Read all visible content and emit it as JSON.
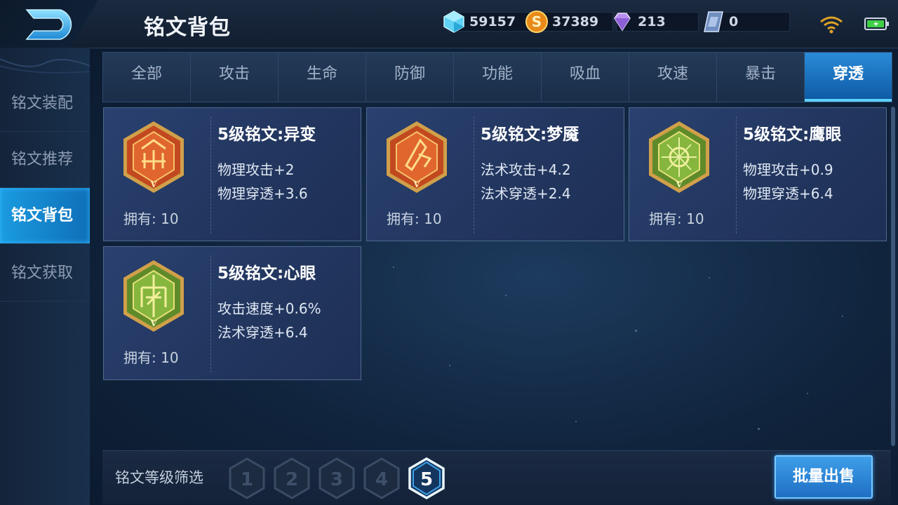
{
  "header": {
    "title": "铭文背包",
    "currencies": [
      {
        "icon": "diamond-icon",
        "amount": "59157"
      },
      {
        "icon": "gold-coin-icon",
        "amount": "37389"
      },
      {
        "icon": "gem-icon",
        "amount": "213"
      },
      {
        "icon": "voucher-icon",
        "amount": "0"
      }
    ]
  },
  "sidebar": {
    "items": [
      {
        "label": "铭文装配",
        "active": false
      },
      {
        "label": "铭文推荐",
        "active": false
      },
      {
        "label": "铭文背包",
        "active": true
      },
      {
        "label": "铭文获取",
        "active": false
      }
    ]
  },
  "tabs": [
    {
      "label": "全部"
    },
    {
      "label": "攻击"
    },
    {
      "label": "生命"
    },
    {
      "label": "防御"
    },
    {
      "label": "功能"
    },
    {
      "label": "吸血"
    },
    {
      "label": "攻速"
    },
    {
      "label": "暴击"
    },
    {
      "label": "穿透",
      "active": true
    }
  ],
  "cards": [
    {
      "name": "5级铭文:异变",
      "stat1": "物理攻击+2",
      "stat2": "物理穿透+3.6",
      "owned": "拥有: 10",
      "color": "red",
      "rank": "V"
    },
    {
      "name": "5级铭文:梦魇",
      "stat1": "法术攻击+4.2",
      "stat2": "法术穿透+2.4",
      "owned": "拥有: 10",
      "color": "red",
      "rank": "V"
    },
    {
      "name": "5级铭文:鹰眼",
      "stat1": "物理攻击+0.9",
      "stat2": "物理穿透+6.4",
      "owned": "拥有: 10",
      "color": "green",
      "rank": "V"
    },
    {
      "name": "5级铭文:心眼",
      "stat1": "攻击速度+0.6%",
      "stat2": "法术穿透+6.4",
      "owned": "拥有: 10",
      "color": "green",
      "rank": "V"
    }
  ],
  "footer": {
    "filter_label": "铭文等级筛选",
    "levels": [
      "1",
      "2",
      "3",
      "4",
      "5"
    ],
    "selected_level": "5",
    "bulk_sell_label": "批量出售"
  },
  "colors": {
    "accent": "#1a9be0",
    "red_emblem": "#c2491f",
    "green_emblem": "#7aa63a"
  }
}
